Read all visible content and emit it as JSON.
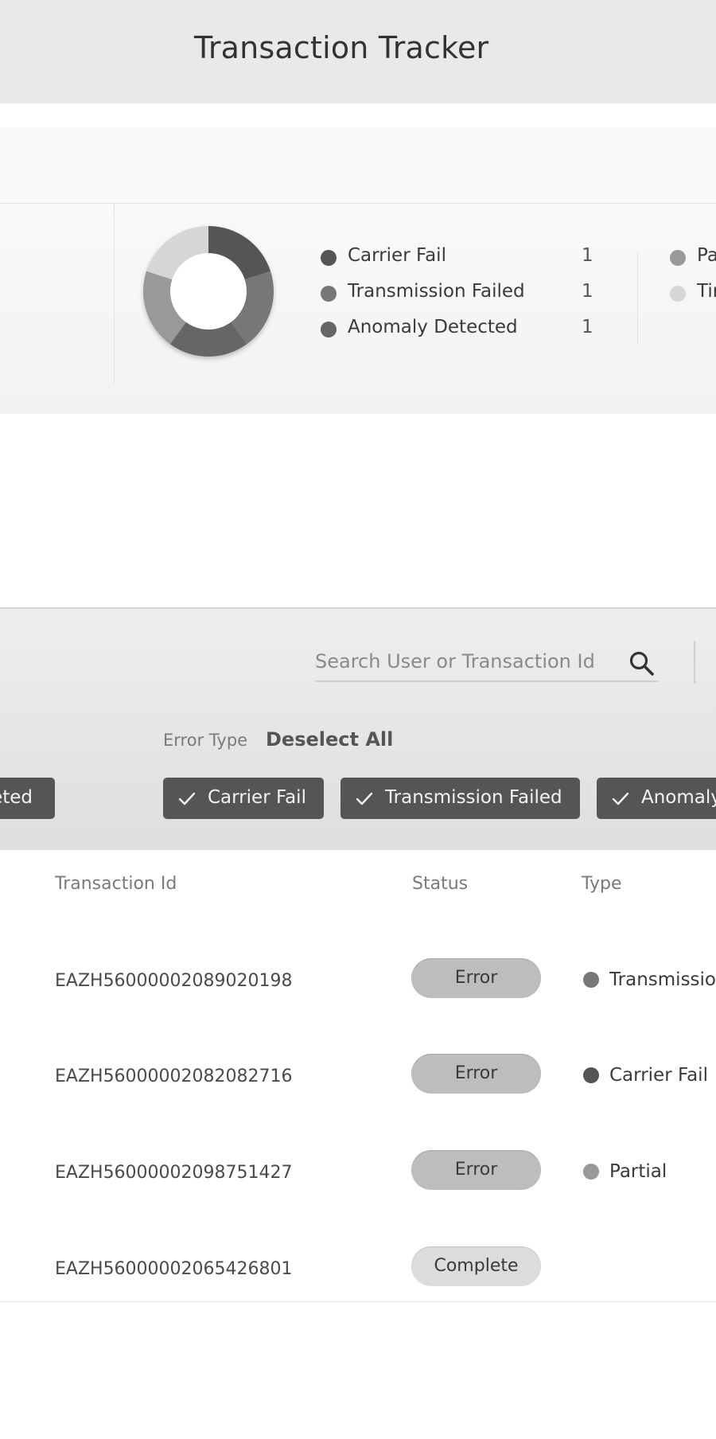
{
  "header": {
    "title": "Transaction Tracker"
  },
  "stats": {
    "legend": [
      {
        "label": "Carrier Fail",
        "count": "1",
        "color": "#555555"
      },
      {
        "label": "Transmission Failed",
        "count": "1",
        "color": "#777777"
      },
      {
        "label": "Anomaly Detected",
        "count": "1",
        "color": "#666666"
      }
    ],
    "legend_right": [
      {
        "label": "Pa",
        "color": "#999999"
      },
      {
        "label": "Tir",
        "color": "#d6d6d6"
      }
    ],
    "donut_segments": [
      {
        "name": "Carrier Fail",
        "value": 1,
        "color": "#555555"
      },
      {
        "name": "Transmission Failed",
        "value": 1,
        "color": "#777777"
      },
      {
        "name": "Anomaly Detected",
        "value": 1,
        "color": "#666666"
      },
      {
        "name": "Pa",
        "value": 1,
        "color": "#999999"
      },
      {
        "name": "Tir",
        "value": 1,
        "color": "#d6d6d6"
      }
    ]
  },
  "filters": {
    "search_placeholder": "Search User or Transaction Id",
    "error_type_label": "Error Type",
    "deselect_all_label": "Deselect All",
    "chips": [
      {
        "label": "eted"
      },
      {
        "label": "Carrier Fail"
      },
      {
        "label": "Transmission Failed"
      },
      {
        "label": "Anomaly"
      }
    ]
  },
  "table": {
    "headers": {
      "transaction_id": "Transaction Id",
      "status": "Status",
      "type": "Type"
    },
    "rows": [
      {
        "id": "EAZH56000002089020198",
        "status": "Error",
        "type": "Transmission",
        "type_color": "#777777"
      },
      {
        "id": "EAZH56000002082082716",
        "status": "Error",
        "type": "Carrier Fail",
        "type_color": "#555555"
      },
      {
        "id": "EAZH56000002098751427",
        "status": "Error",
        "type": "Partial",
        "type_color": "#999999"
      },
      {
        "id": "EAZH56000002065426801",
        "status": "Complete",
        "type": "",
        "type_color": ""
      }
    ]
  }
}
